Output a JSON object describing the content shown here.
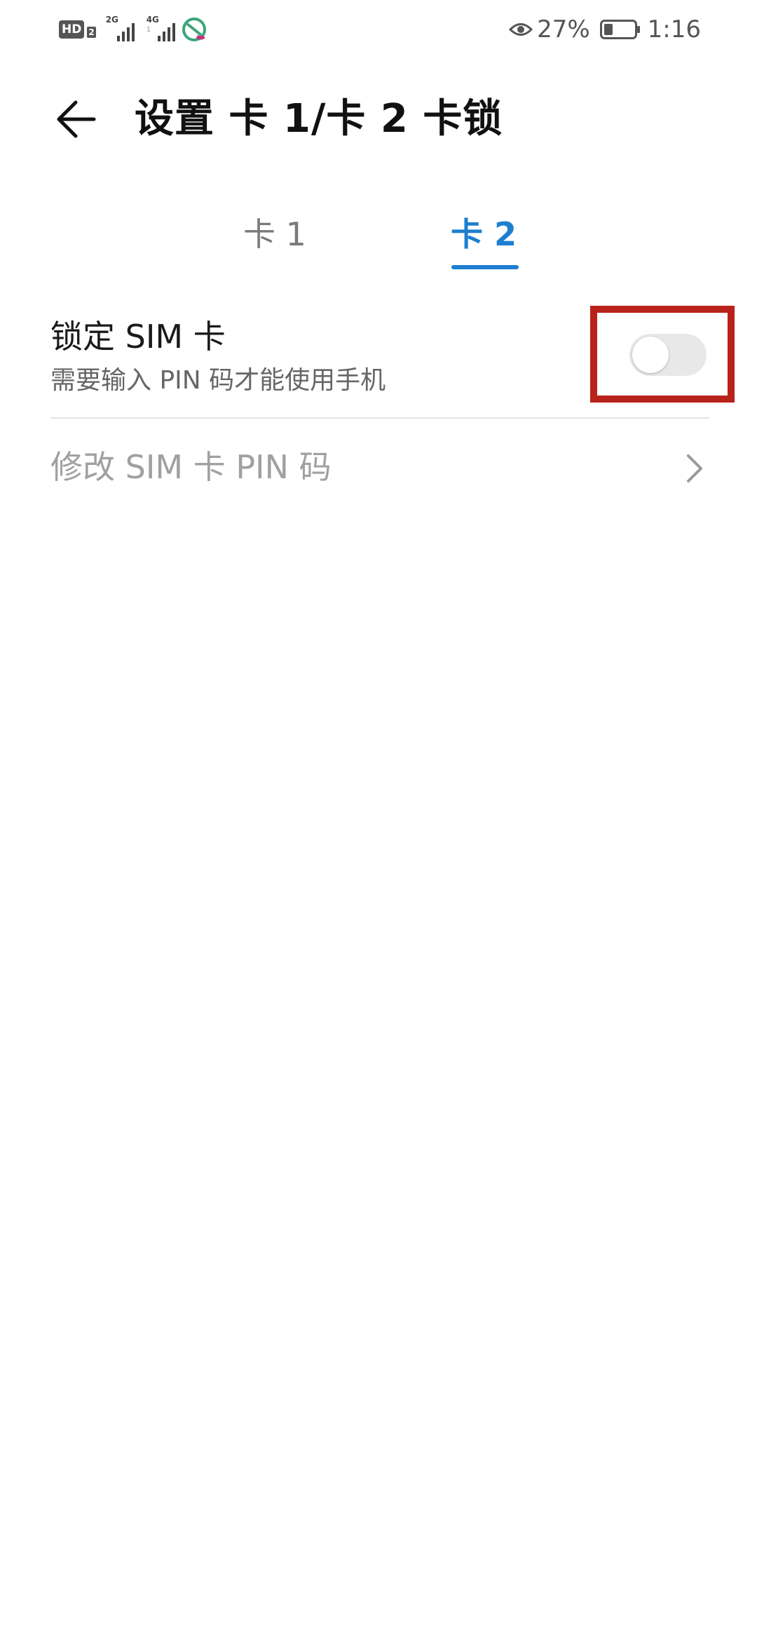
{
  "status_bar": {
    "hd_label": "HD",
    "hd_sim": "2",
    "net1_label": "2G",
    "net2_label": "4G",
    "net2_sub": "1",
    "battery_percent": "27%",
    "time": "1:16",
    "icons": [
      "signal-bars-icon",
      "carrier-logo-icon",
      "eye-icon",
      "battery-icon"
    ]
  },
  "app_bar": {
    "title": "设置 卡 1/卡 2 卡锁",
    "back_icon": "arrow-left-icon"
  },
  "tabs": [
    {
      "label": "卡 1",
      "selected": false
    },
    {
      "label": "卡 2",
      "selected": true
    }
  ],
  "settings": {
    "lock_sim": {
      "title": "锁定 SIM 卡",
      "subtitle": "需要输入 PIN 码才能使用手机",
      "enabled": false
    },
    "change_pin": {
      "label": "修改 SIM 卡 PIN 码",
      "icon": "chevron-right-icon"
    }
  },
  "colors": {
    "accent": "#1d7fd0",
    "highlight_border": "#b8221b",
    "toggle_off_track": "#e8e8e8",
    "disabled_text": "#a0a0a0"
  }
}
